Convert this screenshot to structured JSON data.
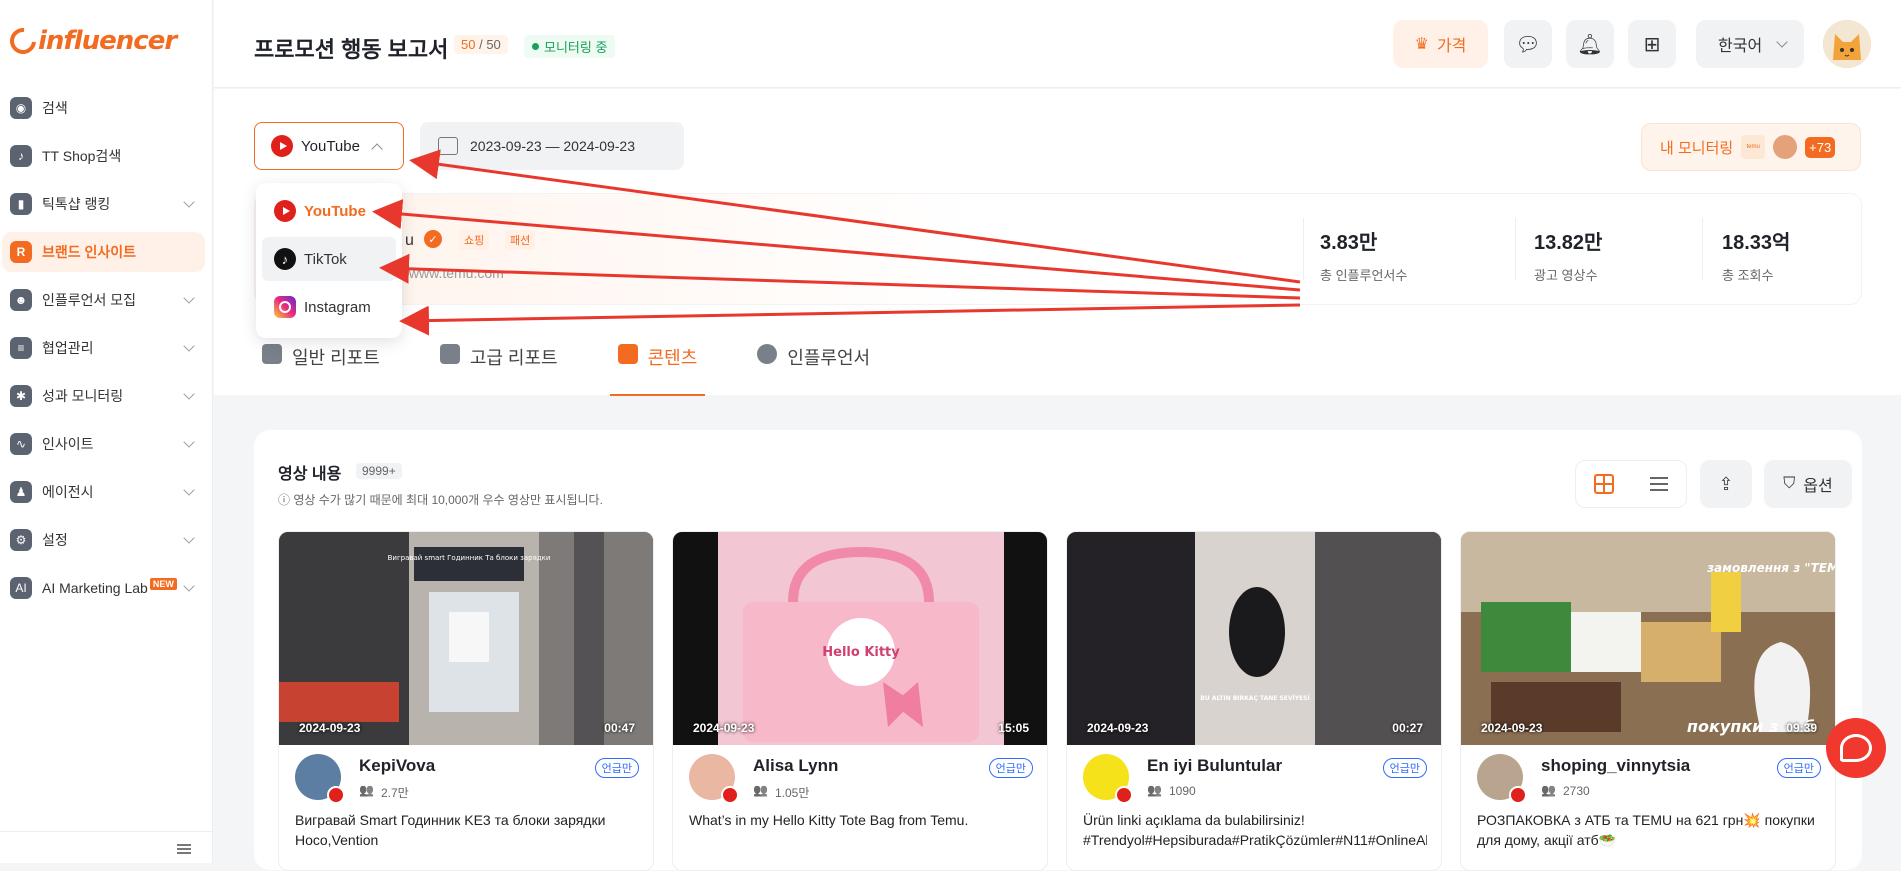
{
  "app": {
    "logo_text": "influencer"
  },
  "sidebar": {
    "items": [
      {
        "label": "검색",
        "icon": "compass-icon"
      },
      {
        "label": "TT Shop검색",
        "icon": "shopping-bag-icon"
      },
      {
        "label": "틱톡샵 랭킹",
        "icon": "bar-chart-icon",
        "expandable": true
      },
      {
        "label": "브랜드 인사이트",
        "icon": "brand-icon",
        "active": true
      },
      {
        "label": "인플루언서 모집",
        "icon": "people-icon",
        "expandable": true
      },
      {
        "label": "협업관리",
        "icon": "document-icon",
        "expandable": true
      },
      {
        "label": "성과 모니터링",
        "icon": "gear-icon",
        "expandable": true
      },
      {
        "label": "인사이트",
        "icon": "trend-icon",
        "expandable": true
      },
      {
        "label": "에이전시",
        "icon": "person-icon",
        "expandable": true
      },
      {
        "label": "설정",
        "icon": "settings-icon",
        "expandable": true
      },
      {
        "label": "AI Marketing Lab",
        "icon": "ai-icon",
        "expandable": true,
        "badge": "NEW"
      }
    ]
  },
  "header": {
    "title": "프로모션 행동 보고서",
    "quota_used": "50",
    "quota_total": "50",
    "monitor_status": "모니터링 중",
    "price_label": "가격",
    "language": "한국어"
  },
  "filters": {
    "platform": "YouTube",
    "date_range": "2023-09-23  —  2024-09-23",
    "my_monitoring_label": "내 모니터링",
    "my_monitoring_extra": "+73"
  },
  "dropdown": {
    "options": [
      "YouTube",
      "TikTok",
      "Instagram"
    ],
    "selected": "YouTube"
  },
  "brand": {
    "name_tail": "u",
    "tags": [
      "쇼핑",
      "패션"
    ],
    "url": "/www.temu.com",
    "stats": [
      {
        "value": "3.83만",
        "label": "총 인플루언서수"
      },
      {
        "value": "13.82만",
        "label": "광고 영상수"
      },
      {
        "value": "18.33억",
        "label": "총 조회수"
      }
    ]
  },
  "tabs": [
    {
      "label": "일반 리포트"
    },
    {
      "label": "고급 리포트"
    },
    {
      "label": "콘텐츠",
      "active": true
    },
    {
      "label": "인플루언서"
    }
  ],
  "content": {
    "section_title": "영상 내용",
    "count": "9999+",
    "note": "ⓘ 영상 수가 많기 때문에 최대 10,000개 우수 영상만 표시됩니다.",
    "option_label": "옵션",
    "videos": [
      {
        "date": "2024-09-23",
        "duration": "00:47",
        "channel": "KepiVova",
        "subs": "2.7만",
        "badge": "언급만",
        "desc": "Вигравай Smart Годинник KE3 та блоки зарядки Hoco,Vention"
      },
      {
        "date": "2024-09-23",
        "duration": "15:05",
        "channel": "Alisa Lynn",
        "subs": "1.05만",
        "badge": "언급만",
        "desc": "What’s in my Hello Kitty Tote Bag from Temu."
      },
      {
        "date": "2024-09-23",
        "duration": "00:27",
        "channel": "En iyi Buluntular",
        "subs": "1090",
        "badge": "언급만",
        "desc": "Ürün linki açıklama da bulabilirsiniz! #Trendyol#Hepsiburada#PratikÇözümler#N11#OnlineAl"
      },
      {
        "date": "2024-09-23",
        "duration": "09:39",
        "channel": "shoping_vinnytsia",
        "subs": "2730",
        "badge": "언급만",
        "desc": "РОЗПАКОВКА з АТБ та TEMU на 621 грн💥 покупки для дому, акції атб🥗"
      }
    ],
    "thumb_texts": {
      "v1": "Вигравай smart Годинник\nТа блоки зарядки",
      "v2": "Hello Kitty",
      "v3": "BU ALTIN BIRKAÇ TANE SEVİYESİ",
      "v4_top": "замовлення з\n\"TEMU\"",
      "v4_bottom": "покупки з атб"
    }
  },
  "colors": {
    "accent": "#f26b21",
    "youtube": "#e0201b",
    "active_bg": "#fff1e8",
    "arrow": "#e8382e"
  }
}
